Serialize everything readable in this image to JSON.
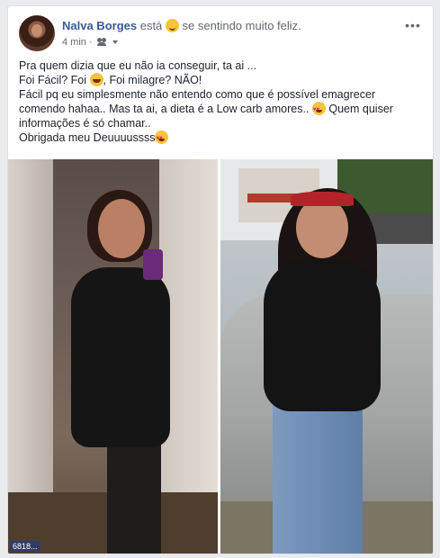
{
  "post": {
    "author": "Nalva Borges",
    "status_verb": "está",
    "feeling_text": "se sentindo muito feliz.",
    "feeling_icon": "smiling-face-icon",
    "time": "4 min",
    "separator": "·",
    "audience_icon": "friends-icon",
    "more_label": "•••",
    "text_lines": {
      "l1": "Pra quem dizia que eu não ia conseguir, ta ai ...",
      "l2a": "Foi Fácil? Foi",
      "l2b": ", Foi milagre? NÃO!",
      "l3": "Fácil pq eu simplesmente não entendo como que é possível emagrecer",
      "l4a": "comendo hahaa.. Mas ta ai, a dieta é a Low carb amores..",
      "l4b": "Quem quiser",
      "l5": "informações é só chamar..",
      "l6": "Obrigada meu Deuuuussss"
    },
    "emoji_icons": {
      "laugh": "laughing-face-icon",
      "hearts": "heart-eyes-icon"
    }
  },
  "photo": {
    "description_left": "after",
    "description_right": "before",
    "watermark": "6818..."
  },
  "colors": {
    "name_link": "#385898",
    "text": "#1d2129",
    "muted": "#616770",
    "background": "#e9ebee"
  }
}
